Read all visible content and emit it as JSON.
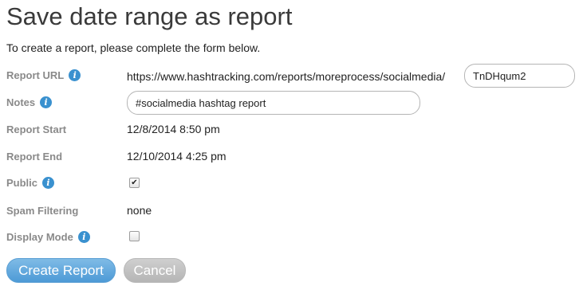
{
  "page": {
    "title": "Save date range as report",
    "intro": "To create a report, please complete the form below."
  },
  "form": {
    "report_url": {
      "label": "Report URL",
      "prefix": "https://www.hashtracking.com/reports/moreprocess/socialmedia/",
      "slug_value": "TnDHqum2",
      "info_icon": "info-icon"
    },
    "notes": {
      "label": "Notes",
      "value": "#socialmedia hashtag report",
      "info_icon": "info-icon"
    },
    "report_start": {
      "label": "Report Start",
      "value": "12/8/2014 8:50 pm"
    },
    "report_end": {
      "label": "Report End",
      "value": "12/10/2014 4:25 pm"
    },
    "public": {
      "label": "Public",
      "checked": true,
      "info_icon": "info-icon"
    },
    "spam_filtering": {
      "label": "Spam Filtering",
      "value": "none"
    },
    "display_mode": {
      "label": "Display Mode",
      "checked": false,
      "info_icon": "info-icon"
    }
  },
  "actions": {
    "create_label": "Create Report",
    "cancel_label": "Cancel"
  },
  "colors": {
    "primary_button": "#5a9fd4",
    "secondary_button": "#b8b8b8",
    "label_text": "#8a8a8a",
    "info_icon": "#3a91cf"
  }
}
